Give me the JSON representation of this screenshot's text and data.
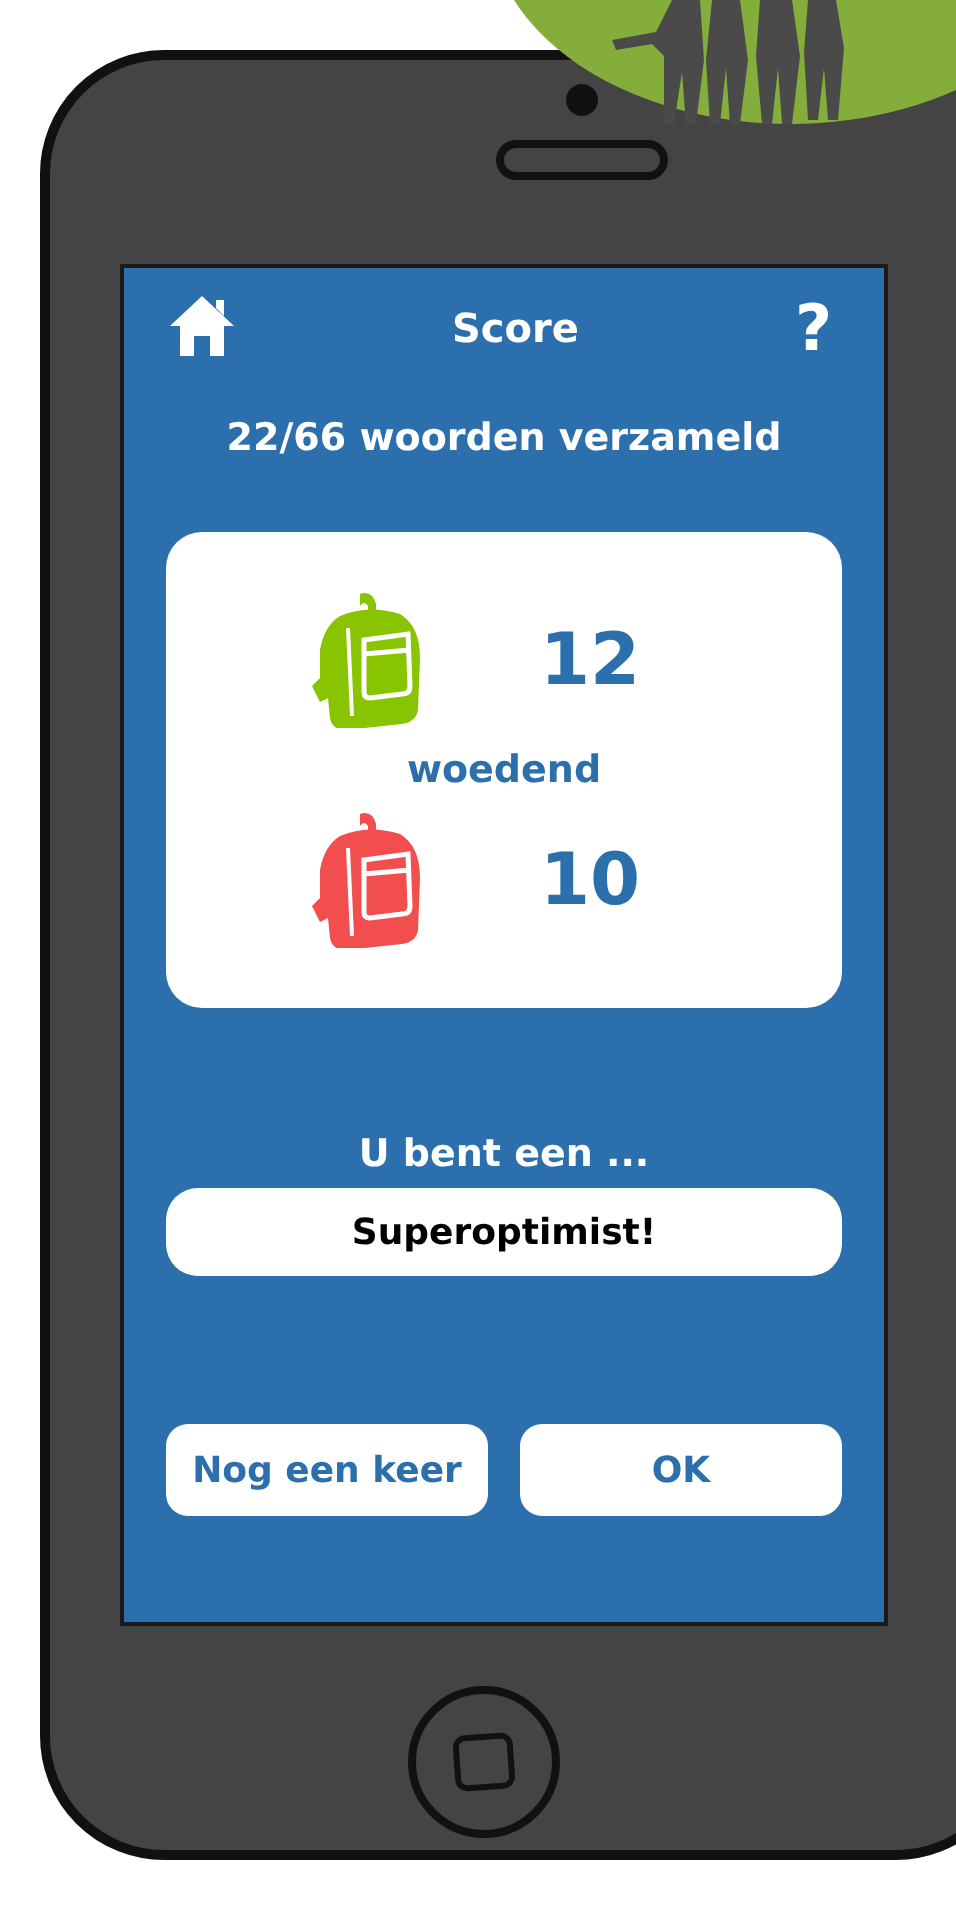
{
  "header": {
    "title": "Score",
    "help": "?"
  },
  "progress": "22/66 woorden verzameld",
  "score_card": {
    "word": "woedend",
    "scores": [
      {
        "color": "#88c400",
        "count": "12"
      },
      {
        "color": "#f24e4e",
        "count": "10"
      }
    ]
  },
  "result": {
    "label": "U bent een ...",
    "value": "Superoptimist!"
  },
  "buttons": [
    "Nog een keer",
    "OK"
  ]
}
